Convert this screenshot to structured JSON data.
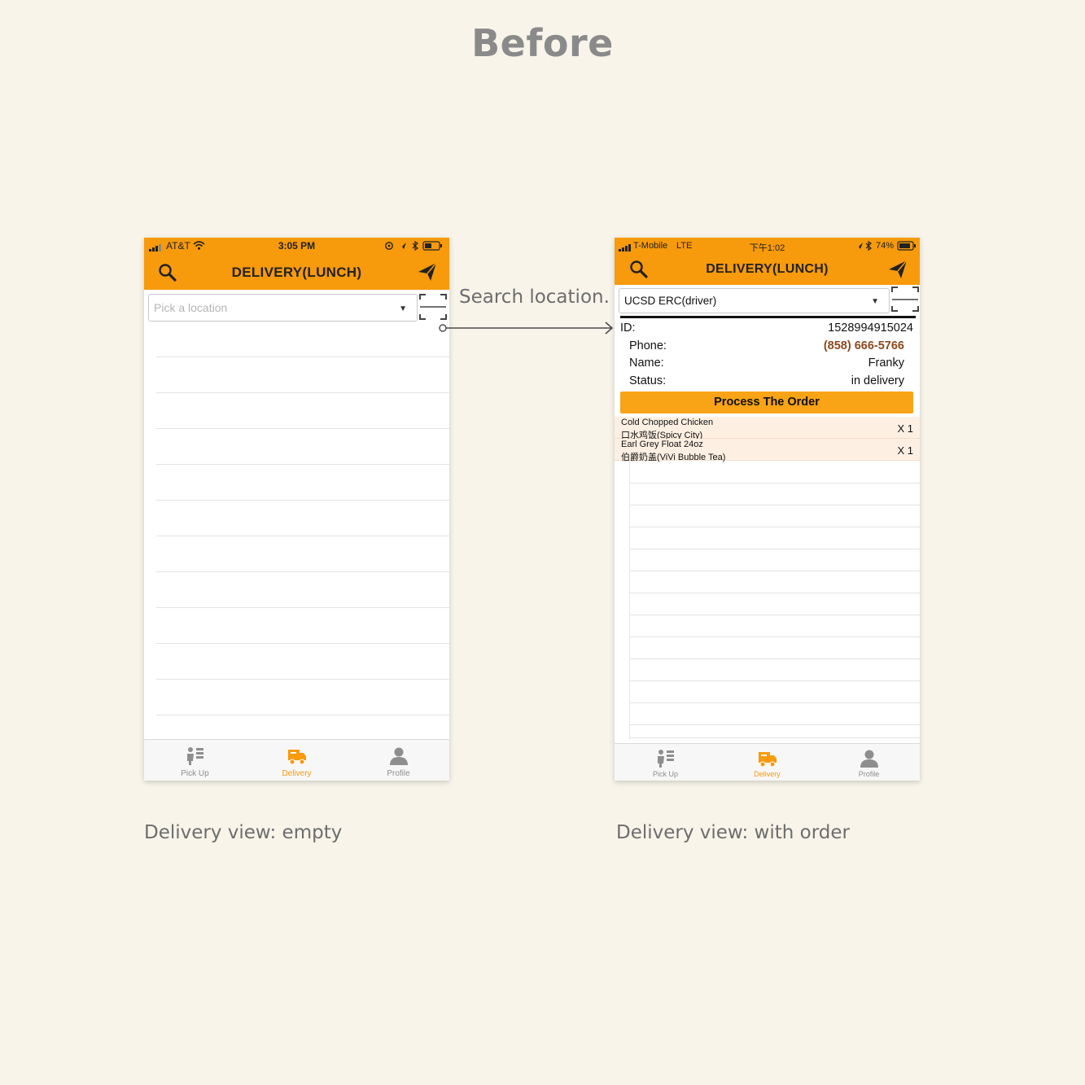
{
  "page_title": "Before",
  "annotation": "Search location.",
  "captions": {
    "left": "Delivery view: empty",
    "right": "Delivery view: with order"
  },
  "colors": {
    "accent": "#f79a0c",
    "background": "#f8f4ea",
    "phone_link": "#8b4a1f"
  },
  "screen_empty": {
    "status": {
      "carrier": "AT&T",
      "time": "3:05 PM"
    },
    "nav": {
      "title": "DELIVERY(LUNCH)",
      "left_icon": "search-icon",
      "right_icon": "send-icon"
    },
    "picker": {
      "placeholder": "Pick a location"
    },
    "tabs": [
      {
        "label": "Pick Up",
        "icon": "pickup-icon"
      },
      {
        "label": "Delivery",
        "icon": "delivery-truck-icon",
        "active": true
      },
      {
        "label": "Profile",
        "icon": "person-icon"
      }
    ]
  },
  "screen_order": {
    "status": {
      "carrier": "T-Mobile",
      "network": "LTE",
      "time": "下午1:02",
      "battery": "74%"
    },
    "nav": {
      "title": "DELIVERY(LUNCH)",
      "left_icon": "search-icon",
      "right_icon": "send-icon"
    },
    "picker": {
      "value": "UCSD ERC(driver)"
    },
    "order": {
      "id_label": "ID:",
      "id": "1528994915024",
      "phone_label": "Phone:",
      "phone": "(858) 666-5766",
      "name_label": "Name:",
      "name": "Franky",
      "status_label": "Status:",
      "status": "in delivery"
    },
    "process_button": "Process The Order",
    "items": [
      {
        "name": "Cold Chopped Chicken",
        "restaurant": "口水鸡饭(Spicy City)",
        "qty": "X 1"
      },
      {
        "name": "Earl Grey Float 24oz",
        "restaurant": "伯爵奶盖(ViVi Bubble Tea)",
        "qty": "X 1"
      }
    ],
    "tabs": [
      {
        "label": "Pick Up",
        "icon": "pickup-icon"
      },
      {
        "label": "Delivery",
        "icon": "delivery-truck-icon",
        "active": true
      },
      {
        "label": "Profile",
        "icon": "person-icon"
      }
    ]
  }
}
